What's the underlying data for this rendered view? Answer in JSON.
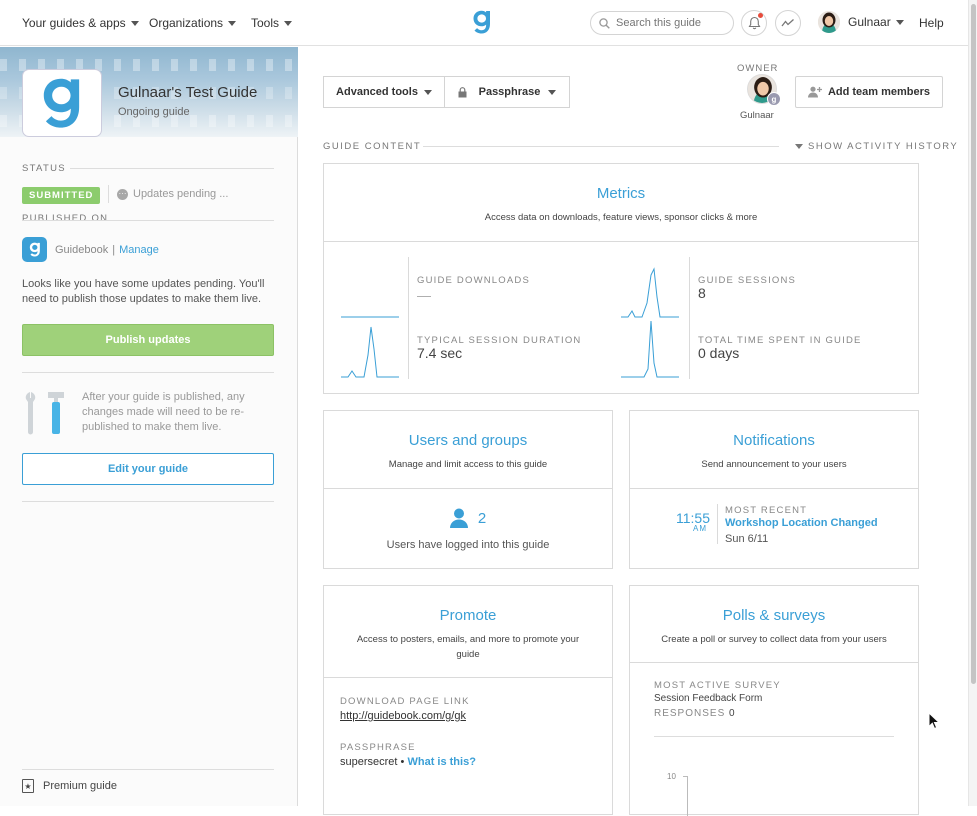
{
  "nav": {
    "menu1": "Your guides & apps",
    "menu2": "Organizations",
    "menu3": "Tools",
    "search_placeholder": "Search this guide",
    "user_name": "Gulnaar",
    "help": "Help"
  },
  "sidebar": {
    "guide_title": "Gulnaar's Test Guide",
    "guide_subtitle": "Ongoing guide",
    "status_label": "STATUS",
    "status_badge": "SUBMITTED",
    "pending_text": "Updates pending ...",
    "published_on_label": "PUBLISHED ON",
    "platform": "Guidebook",
    "separator": "|",
    "manage": "Manage",
    "pending_message": "Looks like you have some updates pending. You'll need to publish those updates to make them live.",
    "publish_button": "Publish updates",
    "tools_note": "After your guide is published, any changes made will need to be re-published to make them live.",
    "edit_button": "Edit your guide",
    "premium": "Premium guide"
  },
  "toolbar": {
    "advanced_tools": "Advanced tools",
    "passphrase": "Passphrase",
    "owner_label": "OWNER",
    "owner_name": "Gulnaar",
    "add_team": "Add team members"
  },
  "content": {
    "section_label": "GUIDE CONTENT",
    "activity_toggle": "SHOW ACTIVITY HISTORY"
  },
  "metrics": {
    "title": "Metrics",
    "desc": "Access data on downloads, feature views, sponsor clicks & more",
    "downloads_label": "GUIDE DOWNLOADS",
    "downloads_value": "—",
    "sessions_label": "GUIDE SESSIONS",
    "sessions_value": "8",
    "duration_label": "TYPICAL SESSION DURATION",
    "duration_value": "7.4 sec",
    "time_label": "TOTAL TIME SPENT IN GUIDE",
    "time_value": "0 days"
  },
  "users": {
    "title": "Users and groups",
    "desc": "Manage and limit access to this guide",
    "count": "2",
    "note": "Users have logged into this guide"
  },
  "notifications": {
    "title": "Notifications",
    "desc": "Send announcement to your users",
    "time": "11:55",
    "ampm": "AM",
    "recent_label": "MOST RECENT",
    "recent_title": "Workshop Location Changed",
    "recent_date": "Sun 6/11"
  },
  "promote": {
    "title": "Promote",
    "desc": "Access to posters, emails, and more to promote your guide",
    "link_label": "DOWNLOAD PAGE LINK",
    "link": "http://guidebook.com/g/gk",
    "pass_label": "PASSPHRASE",
    "pass_value": "supersecret",
    "bullet": "•",
    "what": "What is this?"
  },
  "polls": {
    "title": "Polls & surveys",
    "desc": "Create a poll or survey to collect data from your users",
    "active_label": "MOST ACTIVE SURVEY",
    "survey_name": "Session Feedback Form",
    "responses_label": "RESPONSES",
    "responses_value": "0",
    "axis_tick": "10"
  },
  "colors": {
    "accent": "#3a9fd6",
    "green": "#8ccc6d"
  }
}
